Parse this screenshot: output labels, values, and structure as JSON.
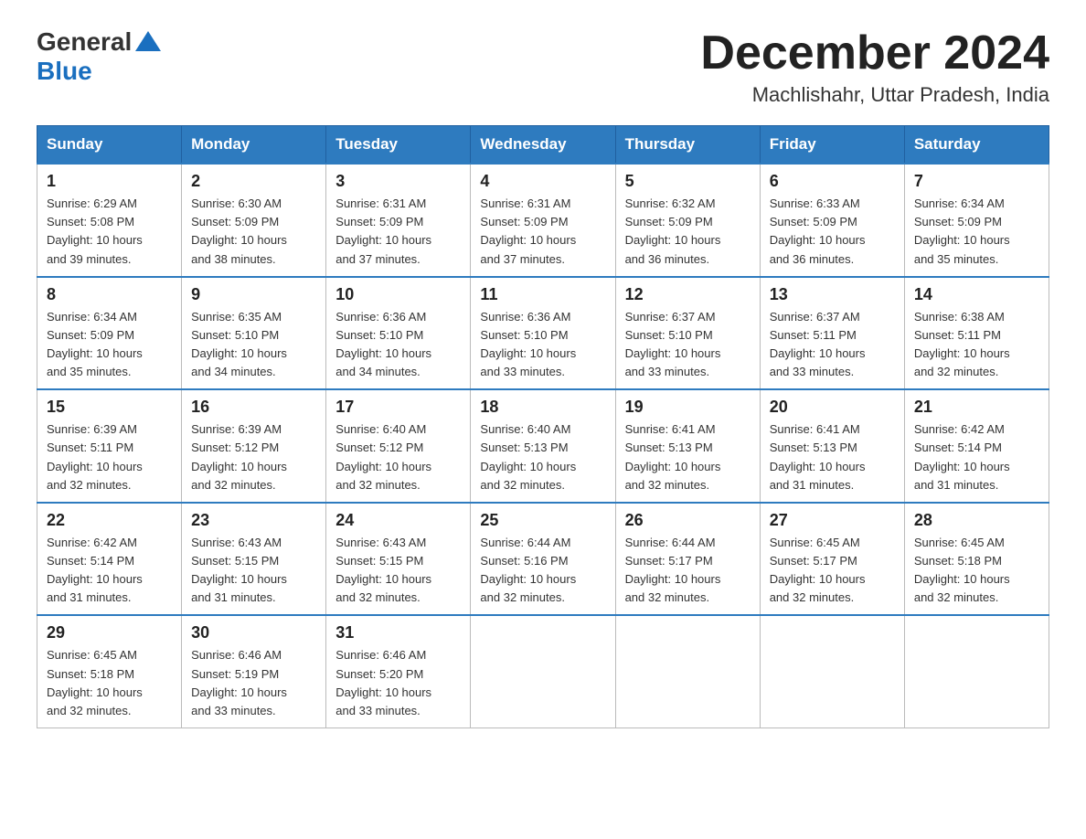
{
  "header": {
    "logo_general": "General",
    "logo_blue": "Blue",
    "month_year": "December 2024",
    "location": "Machlishahr, Uttar Pradesh, India"
  },
  "days_of_week": [
    "Sunday",
    "Monday",
    "Tuesday",
    "Wednesday",
    "Thursday",
    "Friday",
    "Saturday"
  ],
  "weeks": [
    [
      {
        "day": "1",
        "sunrise": "6:29 AM",
        "sunset": "5:08 PM",
        "daylight": "10 hours and 39 minutes."
      },
      {
        "day": "2",
        "sunrise": "6:30 AM",
        "sunset": "5:09 PM",
        "daylight": "10 hours and 38 minutes."
      },
      {
        "day": "3",
        "sunrise": "6:31 AM",
        "sunset": "5:09 PM",
        "daylight": "10 hours and 37 minutes."
      },
      {
        "day": "4",
        "sunrise": "6:31 AM",
        "sunset": "5:09 PM",
        "daylight": "10 hours and 37 minutes."
      },
      {
        "day": "5",
        "sunrise": "6:32 AM",
        "sunset": "5:09 PM",
        "daylight": "10 hours and 36 minutes."
      },
      {
        "day": "6",
        "sunrise": "6:33 AM",
        "sunset": "5:09 PM",
        "daylight": "10 hours and 36 minutes."
      },
      {
        "day": "7",
        "sunrise": "6:34 AM",
        "sunset": "5:09 PM",
        "daylight": "10 hours and 35 minutes."
      }
    ],
    [
      {
        "day": "8",
        "sunrise": "6:34 AM",
        "sunset": "5:09 PM",
        "daylight": "10 hours and 35 minutes."
      },
      {
        "day": "9",
        "sunrise": "6:35 AM",
        "sunset": "5:10 PM",
        "daylight": "10 hours and 34 minutes."
      },
      {
        "day": "10",
        "sunrise": "6:36 AM",
        "sunset": "5:10 PM",
        "daylight": "10 hours and 34 minutes."
      },
      {
        "day": "11",
        "sunrise": "6:36 AM",
        "sunset": "5:10 PM",
        "daylight": "10 hours and 33 minutes."
      },
      {
        "day": "12",
        "sunrise": "6:37 AM",
        "sunset": "5:10 PM",
        "daylight": "10 hours and 33 minutes."
      },
      {
        "day": "13",
        "sunrise": "6:37 AM",
        "sunset": "5:11 PM",
        "daylight": "10 hours and 33 minutes."
      },
      {
        "day": "14",
        "sunrise": "6:38 AM",
        "sunset": "5:11 PM",
        "daylight": "10 hours and 32 minutes."
      }
    ],
    [
      {
        "day": "15",
        "sunrise": "6:39 AM",
        "sunset": "5:11 PM",
        "daylight": "10 hours and 32 minutes."
      },
      {
        "day": "16",
        "sunrise": "6:39 AM",
        "sunset": "5:12 PM",
        "daylight": "10 hours and 32 minutes."
      },
      {
        "day": "17",
        "sunrise": "6:40 AM",
        "sunset": "5:12 PM",
        "daylight": "10 hours and 32 minutes."
      },
      {
        "day": "18",
        "sunrise": "6:40 AM",
        "sunset": "5:13 PM",
        "daylight": "10 hours and 32 minutes."
      },
      {
        "day": "19",
        "sunrise": "6:41 AM",
        "sunset": "5:13 PM",
        "daylight": "10 hours and 32 minutes."
      },
      {
        "day": "20",
        "sunrise": "6:41 AM",
        "sunset": "5:13 PM",
        "daylight": "10 hours and 31 minutes."
      },
      {
        "day": "21",
        "sunrise": "6:42 AM",
        "sunset": "5:14 PM",
        "daylight": "10 hours and 31 minutes."
      }
    ],
    [
      {
        "day": "22",
        "sunrise": "6:42 AM",
        "sunset": "5:14 PM",
        "daylight": "10 hours and 31 minutes."
      },
      {
        "day": "23",
        "sunrise": "6:43 AM",
        "sunset": "5:15 PM",
        "daylight": "10 hours and 31 minutes."
      },
      {
        "day": "24",
        "sunrise": "6:43 AM",
        "sunset": "5:15 PM",
        "daylight": "10 hours and 32 minutes."
      },
      {
        "day": "25",
        "sunrise": "6:44 AM",
        "sunset": "5:16 PM",
        "daylight": "10 hours and 32 minutes."
      },
      {
        "day": "26",
        "sunrise": "6:44 AM",
        "sunset": "5:17 PM",
        "daylight": "10 hours and 32 minutes."
      },
      {
        "day": "27",
        "sunrise": "6:45 AM",
        "sunset": "5:17 PM",
        "daylight": "10 hours and 32 minutes."
      },
      {
        "day": "28",
        "sunrise": "6:45 AM",
        "sunset": "5:18 PM",
        "daylight": "10 hours and 32 minutes."
      }
    ],
    [
      {
        "day": "29",
        "sunrise": "6:45 AM",
        "sunset": "5:18 PM",
        "daylight": "10 hours and 32 minutes."
      },
      {
        "day": "30",
        "sunrise": "6:46 AM",
        "sunset": "5:19 PM",
        "daylight": "10 hours and 33 minutes."
      },
      {
        "day": "31",
        "sunrise": "6:46 AM",
        "sunset": "5:20 PM",
        "daylight": "10 hours and 33 minutes."
      },
      null,
      null,
      null,
      null
    ]
  ],
  "labels": {
    "sunrise": "Sunrise: ",
    "sunset": "Sunset: ",
    "daylight": "Daylight: "
  }
}
